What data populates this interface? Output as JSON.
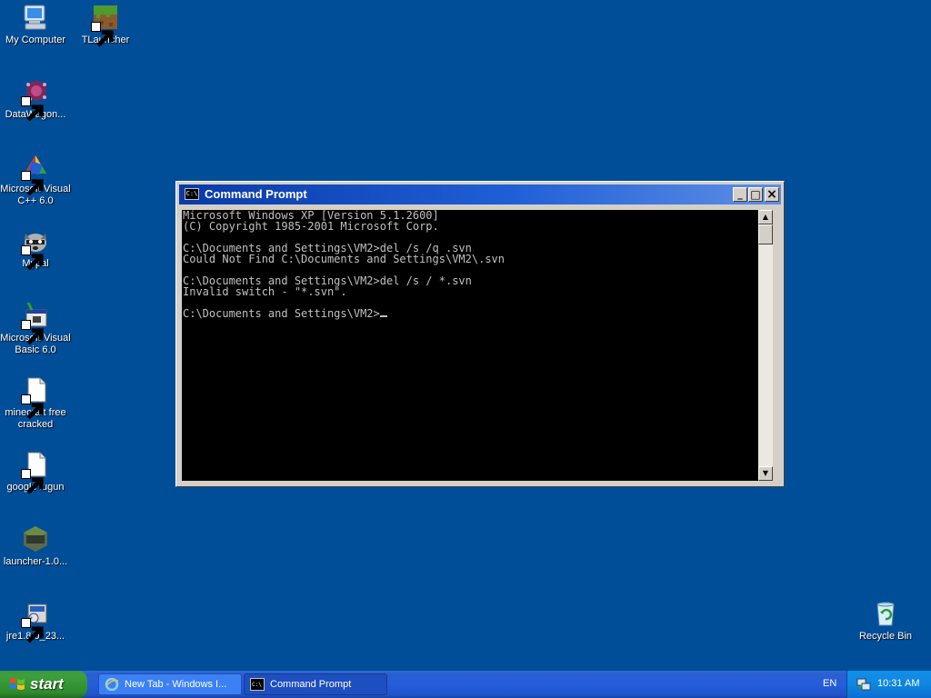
{
  "desktop": {
    "icons": [
      {
        "label": "My Computer"
      },
      {
        "label": "TLauncher"
      },
      {
        "label": "DataWagon..."
      },
      {
        "label": "Microsoft Visual C++ 6.0"
      },
      {
        "label": "Mypal"
      },
      {
        "label": "Microsoft Visual Basic 6.0"
      },
      {
        "label": "minecraft free cracked"
      },
      {
        "label": "google lugun"
      },
      {
        "label": "launcher-1.0..."
      },
      {
        "label": "jre1.8.0_23..."
      },
      {
        "label": "Recycle Bin"
      }
    ],
    "background_color": "#004e98"
  },
  "cmd": {
    "title": "Command Prompt",
    "icon_text": "C:\\",
    "lines": [
      "Microsoft Windows XP [Version 5.1.2600]",
      "(C) Copyright 1985-2001 Microsoft Corp.",
      "",
      "C:\\Documents and Settings\\VM2>del /s /q .svn",
      "Could Not Find C:\\Documents and Settings\\VM2\\.svn",
      "",
      "C:\\Documents and Settings\\VM2>del /s / *.svn",
      "Invalid switch - \"*.svn\".",
      ""
    ],
    "prompt": "C:\\Documents and Settings\\VM2>",
    "buttons": {
      "minimize": "_",
      "maximize": "□",
      "close": "×"
    }
  },
  "taskbar": {
    "start_label": "start",
    "tasks": [
      {
        "label": "New Tab - Windows I...",
        "icon": "ie-icon",
        "active": false
      },
      {
        "label": "Command Prompt",
        "icon": "cmd-icon",
        "active": true
      }
    ],
    "language": "EN",
    "clock": "10:31 AM"
  }
}
